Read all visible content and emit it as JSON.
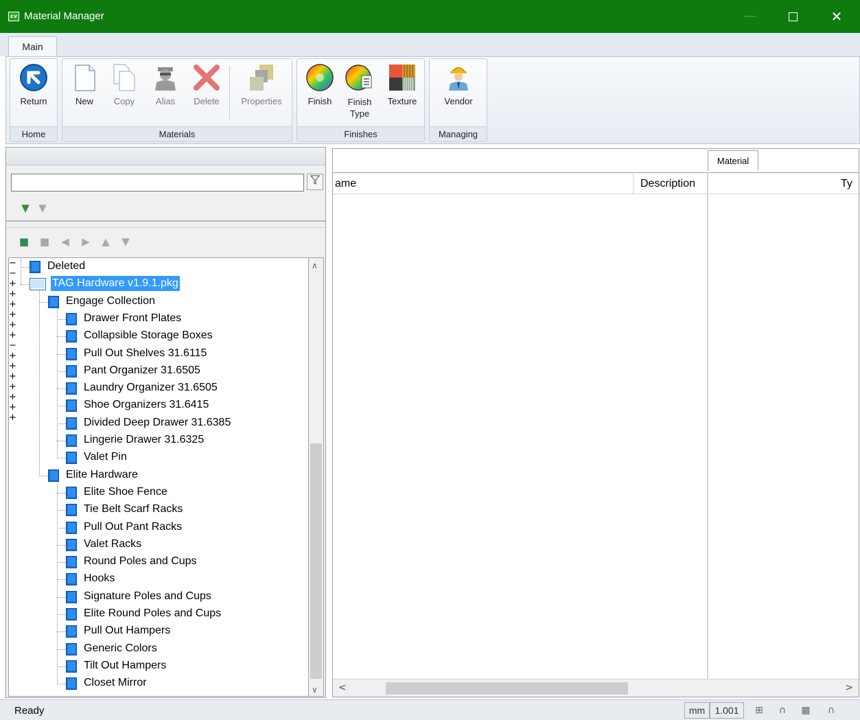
{
  "window": {
    "logo_text": "cv",
    "title": "Material Manager",
    "minimize_glyph": "—",
    "close_glyph": "✕"
  },
  "ribbon": {
    "tab_label": "Main",
    "groups": {
      "home": {
        "label": "Home",
        "buttons": {
          "return": "Return"
        }
      },
      "materials": {
        "label": "Materials",
        "buttons": {
          "new": "New",
          "copy": "Copy",
          "alias": "Alias",
          "delete": "Delete",
          "properties": "Properties"
        }
      },
      "finishes": {
        "label": "Finishes",
        "buttons": {
          "finish": "Finish",
          "finish_type_1": "Finish",
          "finish_type_2": "Type",
          "texture": "Texture"
        }
      },
      "managing": {
        "label": "Managing",
        "buttons": {
          "vendor": "Vendor"
        }
      }
    }
  },
  "left_panel": {
    "search_value": "",
    "filter_icon": "funnel-icon",
    "tree": [
      {
        "label": "Deleted",
        "level": 1,
        "expander": "",
        "selected": false
      },
      {
        "label": "TAG Hardware v1.9.1.pkg",
        "level": 1,
        "expander": "−",
        "selected": true
      },
      {
        "label": "Engage Collection",
        "level": 2,
        "expander": "−",
        "selected": false
      },
      {
        "label": "Drawer Front Plates",
        "level": 3,
        "expander": "",
        "selected": false
      },
      {
        "label": "Collapsible Storage Boxes",
        "level": 3,
        "expander": "",
        "selected": false
      },
      {
        "label": "Pull Out Shelves 31.6115",
        "level": 3,
        "expander": "+",
        "selected": false
      },
      {
        "label": "Pant Organizer 31.6505",
        "level": 3,
        "expander": "+",
        "selected": false
      },
      {
        "label": "Laundry Organizer 31.6505",
        "level": 3,
        "expander": "+",
        "selected": false
      },
      {
        "label": "Shoe Organizers 31.6415",
        "level": 3,
        "expander": "+",
        "selected": false
      },
      {
        "label": "Divided Deep Drawer 31.6385",
        "level": 3,
        "expander": "+",
        "selected": false
      },
      {
        "label": "Lingerie Drawer 31.6325",
        "level": 3,
        "expander": "+",
        "selected": false
      },
      {
        "label": "Valet Pin",
        "level": 3,
        "expander": "",
        "selected": false
      },
      {
        "label": "Elite Hardware",
        "level": 2,
        "expander": "−",
        "selected": false
      },
      {
        "label": "Elite Shoe Fence",
        "level": 3,
        "expander": "",
        "selected": false
      },
      {
        "label": "Tie Belt Scarf Racks",
        "level": 3,
        "expander": "+",
        "selected": false
      },
      {
        "label": "Pull Out Pant Racks",
        "level": 3,
        "expander": "+",
        "selected": false
      },
      {
        "label": "Valet Racks",
        "level": 3,
        "expander": "",
        "selected": false
      },
      {
        "label": "Round Poles and Cups",
        "level": 3,
        "expander": "+",
        "selected": false
      },
      {
        "label": "Hooks",
        "level": 3,
        "expander": "+",
        "selected": false
      },
      {
        "label": "Signature Poles and Cups",
        "level": 3,
        "expander": "+",
        "selected": false
      },
      {
        "label": "Elite Round Poles and Cups",
        "level": 3,
        "expander": "+",
        "selected": false
      },
      {
        "label": "Pull Out Hampers",
        "level": 3,
        "expander": "+",
        "selected": false
      },
      {
        "label": "Generic Colors",
        "level": 3,
        "expander": "",
        "selected": false
      },
      {
        "label": "Tilt Out Hampers",
        "level": 3,
        "expander": "",
        "selected": false
      },
      {
        "label": "Closet Mirror",
        "level": 3,
        "expander": "",
        "selected": false
      }
    ]
  },
  "right_panel": {
    "tab_label": "Material",
    "columns": [
      "ame",
      "Description",
      "Ty"
    ]
  },
  "statusbar": {
    "status": "Ready",
    "units": "mm",
    "scale": "1.001"
  },
  "colors": {
    "titlebar": "#0f7b0f",
    "selection": "#3399ff",
    "book_icon": "#1a73d6"
  }
}
